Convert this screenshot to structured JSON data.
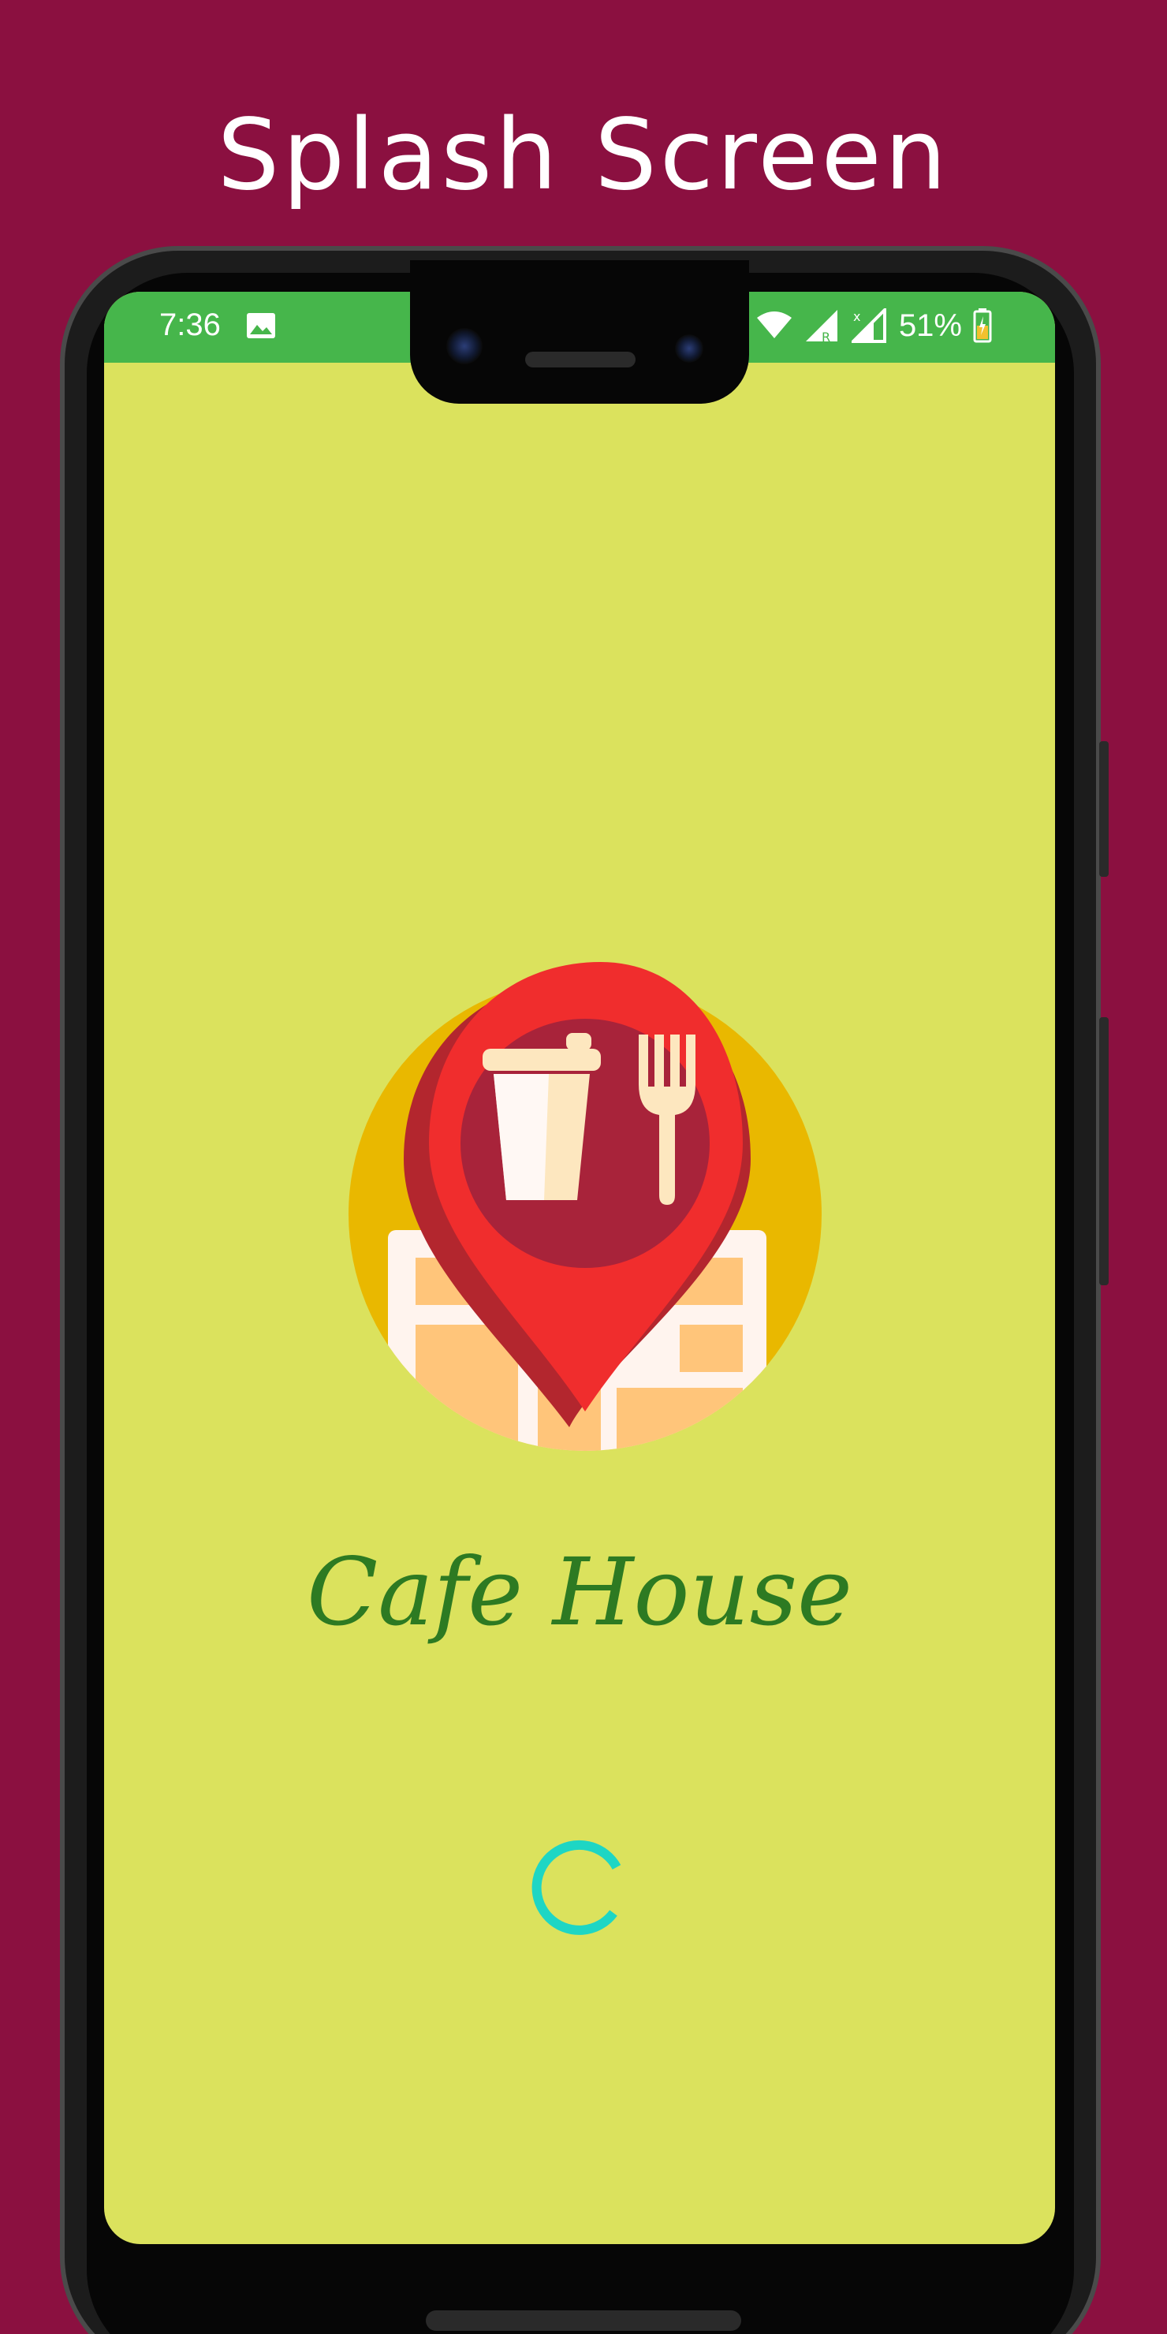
{
  "page": {
    "title": "Splash Screen",
    "background_color": "#8b1040"
  },
  "status_bar": {
    "time": "7:36",
    "battery_percent": "51%",
    "color": "#46b64b",
    "icons": [
      "image-icon",
      "wifi-icon",
      "signal-r-icon",
      "signal-x-icon",
      "battery-charging-icon"
    ]
  },
  "app": {
    "name": "Cafe House",
    "screen_color": "#dbe25d",
    "logo": "cafe-location-pin-icon",
    "loading_indicator": "spinner"
  },
  "colors": {
    "name_text": "#2d7a22",
    "spinner": "#1ed6c4",
    "pin": "#f02d2d"
  }
}
